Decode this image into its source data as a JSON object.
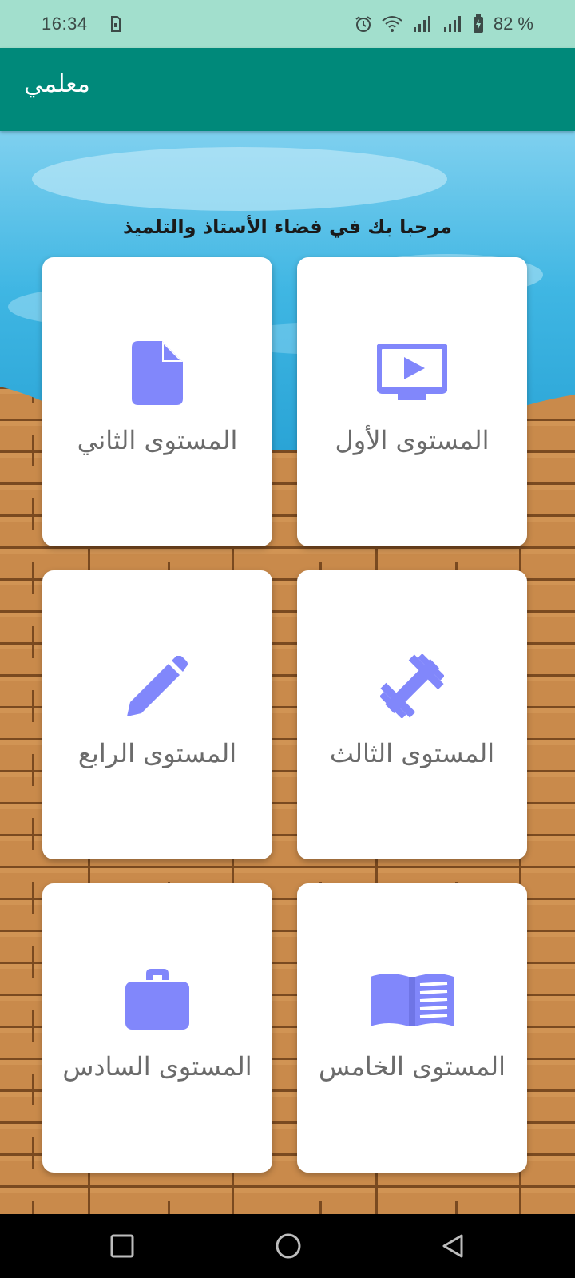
{
  "status_bar": {
    "time": "16:34",
    "battery": "82 %",
    "icons": [
      "sim-icon",
      "alarm-icon",
      "wifi-icon",
      "signal-icon",
      "signal-icon",
      "battery-charging-icon"
    ]
  },
  "app_bar": {
    "title": "معلمي"
  },
  "welcome_text": "مرحبا بك في فضاء الأستاذ والتلميذ",
  "cards": [
    {
      "label": "المستوى الأول",
      "icon": "tv-play-icon"
    },
    {
      "label": "المستوى الثاني",
      "icon": "document-icon"
    },
    {
      "label": "المستوى الثالث",
      "icon": "dumbbell-icon"
    },
    {
      "label": "المستوى الرابع",
      "icon": "pencil-icon"
    },
    {
      "label": "المستوى الخامس",
      "icon": "open-book-icon"
    },
    {
      "label": "المستوى السادس",
      "icon": "briefcase-icon"
    }
  ],
  "colors": {
    "status_bar": "#a2dfcd",
    "app_bar": "#00897a",
    "icon_accent": "#8187fb",
    "card_label": "#6b6b6b",
    "water": "#3fb6e3",
    "wood": "#c98a4b"
  },
  "nav_bar": {
    "buttons": [
      "recents-button",
      "home-button",
      "back-button"
    ]
  }
}
